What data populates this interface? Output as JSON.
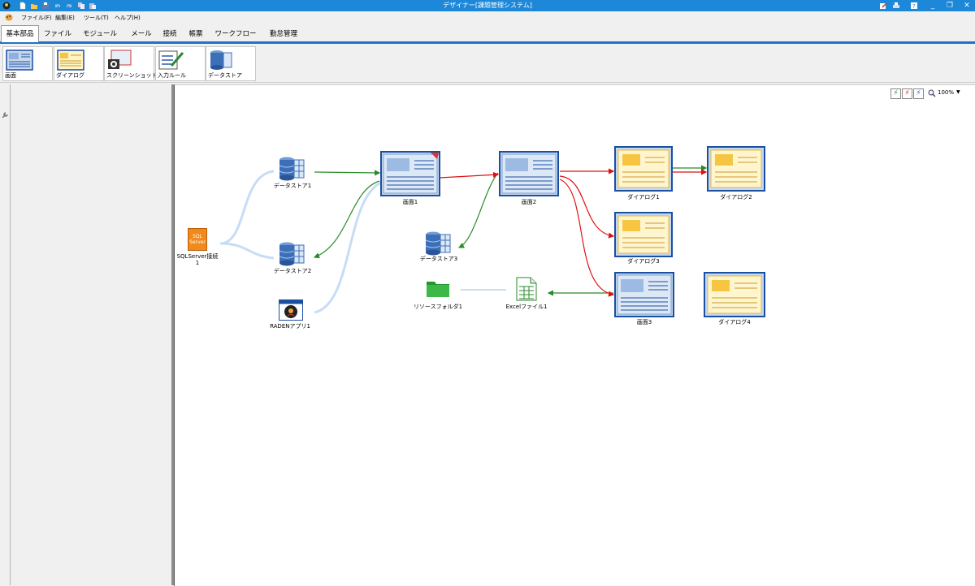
{
  "window": {
    "title": "デザイナー[課題管理システム]"
  },
  "menu": {
    "items": [
      "ファイル(F)",
      "編集(E)",
      "ツール(T)",
      "ヘルプ(H)"
    ]
  },
  "tabs": [
    "基本部品",
    "ファイル",
    "モジュール",
    "メール",
    "接続",
    "帳票",
    "ワークフロー",
    "勤怠管理"
  ],
  "palette": {
    "items": [
      "画面",
      "ダイアログ",
      "スクリーンショット",
      "入力ルール",
      "データストア"
    ]
  },
  "canvas_toolbar": {
    "zoom": "100%"
  },
  "nodes": {
    "sqlserver": "SQLServer接続1",
    "ds1": "データストア1",
    "ds2": "データストア2",
    "ds3": "データストア3",
    "raden": "RADENアプリ1",
    "screen1": "画面1",
    "screen2": "画面2",
    "screen3": "画面3",
    "dialog1": "ダイアログ1",
    "dialog2": "ダイアログ2",
    "dialog3": "ダイアログ3",
    "dialog4": "ダイアログ4",
    "folder": "リソースフォルダ1",
    "excel": "Excelファイル1",
    "sql_icon_text": "SQL Server"
  },
  "colors": {
    "accent": "#1e73c8",
    "titlebar": "#1e88d8",
    "link_red": "#e01010",
    "link_green": "#2a8a2a",
    "link_blue": "#c8dcf5"
  }
}
